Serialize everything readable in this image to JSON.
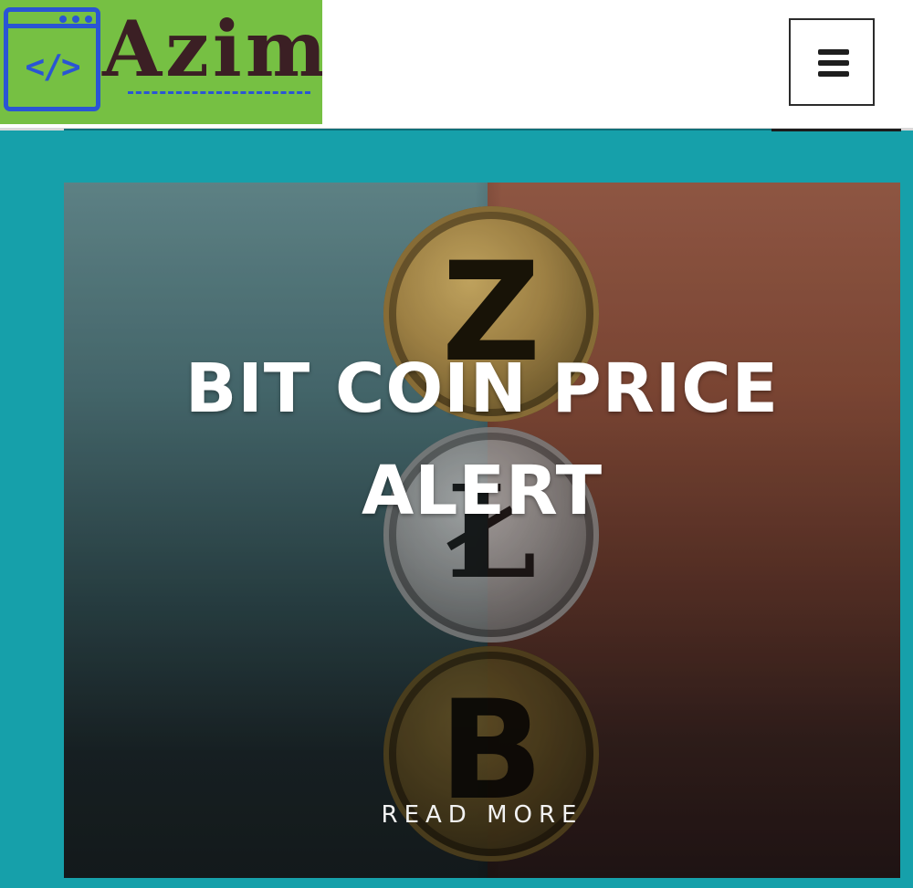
{
  "header": {
    "logo": {
      "code_symbol": "</>",
      "brand_text": "Azim",
      "background_color": "#76c043",
      "accent_color": "#2a55d4"
    },
    "menu_icon": "hamburger-menu-icon"
  },
  "hero": {
    "title": "BIT COIN PRICE ALERT",
    "read_more_label": "READ MORE",
    "background_image": "crypto-coins-image",
    "coins": [
      "zcash-coin",
      "litecoin-coin",
      "bitcoin-coin"
    ],
    "coin_glyphs": {
      "zcash": "Z",
      "litecoin": "Ł",
      "bitcoin": "B"
    }
  },
  "colors": {
    "section_background": "#16a0aa",
    "title_text": "#ffffff"
  }
}
